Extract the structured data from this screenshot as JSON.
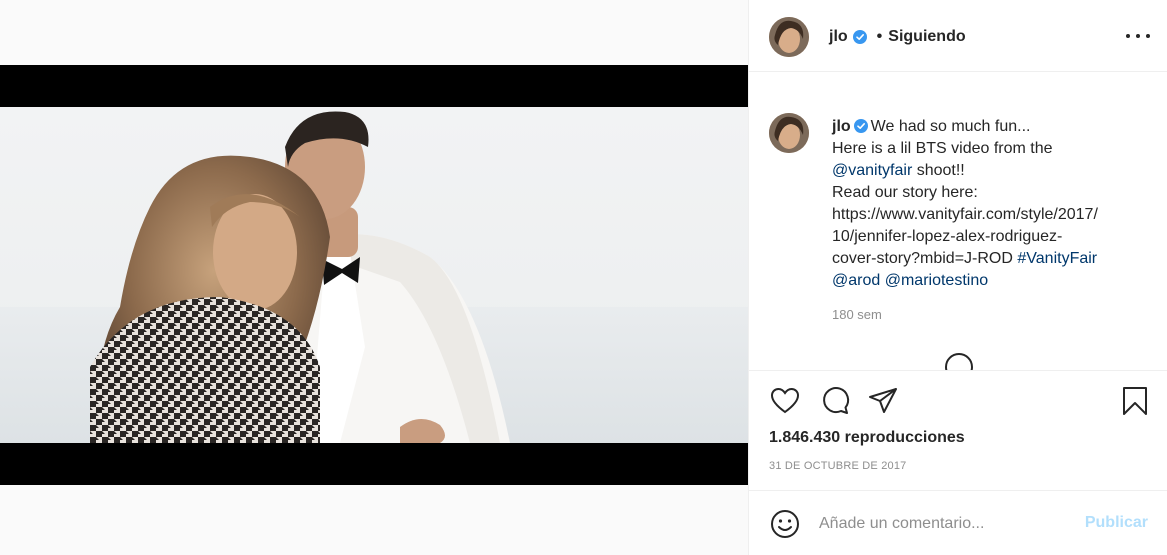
{
  "post": {
    "username": "jlo",
    "follow_status": "Siguiendo",
    "separator": "•",
    "caption": {
      "username": "jlo",
      "text_1": "We had so much fun...",
      "text_2": "Here is a lil BTS video from the",
      "mention_1": "@vanityfair",
      "text_3": " shoot!!",
      "text_4": "Read our story here:",
      "url_line_1": "https://www.vanityfair.com/style/2017/",
      "url_line_2": "10/jennifer-lopez-alex-rodriguez-",
      "url_line_3": "cover-story?mbid=J-ROD",
      "hashtag": "#VanityFair",
      "mention_2": "@arod",
      "mention_3": "@mariotestino"
    },
    "time_ago": "180 sem",
    "views": "1.846.430 reproducciones",
    "date": "31 DE OCTUBRE DE 2017"
  },
  "comment_box": {
    "placeholder": "Añade un comentario...",
    "publish_label": "Publicar"
  },
  "icons": {
    "more": "more-options-icon",
    "like": "heart-icon",
    "comment": "comment-icon",
    "share": "paper-plane-icon",
    "save": "bookmark-icon",
    "emoji": "smiley-icon",
    "mute": "speaker-muted-icon",
    "verified": "verified-badge-icon"
  },
  "colors": {
    "text": "#262626",
    "secondary": "#8e8e8e",
    "link": "#00376b",
    "verified": "#3897f0",
    "publish_disabled": "#b2dffc",
    "divider": "#efefef"
  }
}
